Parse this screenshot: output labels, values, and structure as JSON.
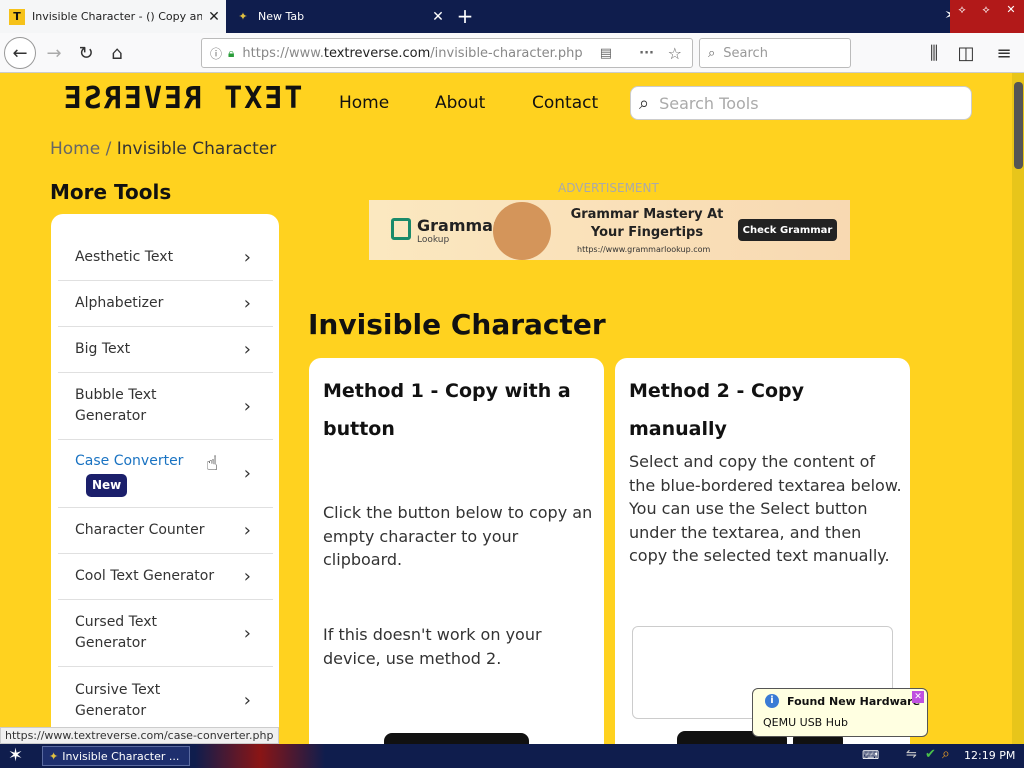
{
  "browser": {
    "tabs": [
      {
        "title": "Invisible Character - () Copy and P",
        "favicon": "T"
      },
      {
        "title": "New Tab"
      }
    ],
    "url_prefix": "https://www.",
    "url_domain": "textreverse.com",
    "url_path": "/invisible-character.php",
    "search_placeholder": "Search"
  },
  "site": {
    "logo": "TEXT REVERSE",
    "nav": [
      "Home",
      "About",
      "Contact"
    ],
    "search_placeholder": "Search Tools"
  },
  "breadcrumb": {
    "home": "Home",
    "sep": "/",
    "current": "Invisible Character"
  },
  "sidebar": {
    "heading": "More Tools",
    "items": [
      {
        "label": "Aesthetic Text"
      },
      {
        "label": "Alphabetizer"
      },
      {
        "label": "Big Text"
      },
      {
        "label": "Bubble Text Generator"
      },
      {
        "label": "Case Converter",
        "badge": "New"
      },
      {
        "label": "Character Counter"
      },
      {
        "label": "Cool Text Generator"
      },
      {
        "label": "Cursed Text Generator"
      },
      {
        "label": "Cursive Text Generator"
      }
    ]
  },
  "ad": {
    "label": "ADVERTISEMENT",
    "brand": "Grammar",
    "brand_sub": "Lookup",
    "headline": "Grammar Mastery At Your Fingertips",
    "url": "https://www.grammarlookup.com",
    "cta": "Check Grammar"
  },
  "main": {
    "title": "Invisible Character",
    "method1": {
      "title": "Method 1 - Copy with a button",
      "p1": "Click the button below to copy an empty character to your clipboard.",
      "p2": "If this doesn't work on your device, use method 2."
    },
    "method2": {
      "title": "Method 2 - Copy manually",
      "p1": "Select and copy the content of the blue-bordered textarea below. You can use the Select button under the textarea, and then copy the selected text manually."
    }
  },
  "status_url": "https://www.textreverse.com/case-converter.php",
  "notification": {
    "title": "Found New Hardware",
    "body": "QEMU USB Hub"
  },
  "taskbar": {
    "window": "Invisible Character ...",
    "clock": "12:19 PM"
  },
  "colors": {
    "page_bg": "#ffd21f",
    "link_active": "#1a73c2",
    "badge_bg": "#1b1f6b"
  }
}
